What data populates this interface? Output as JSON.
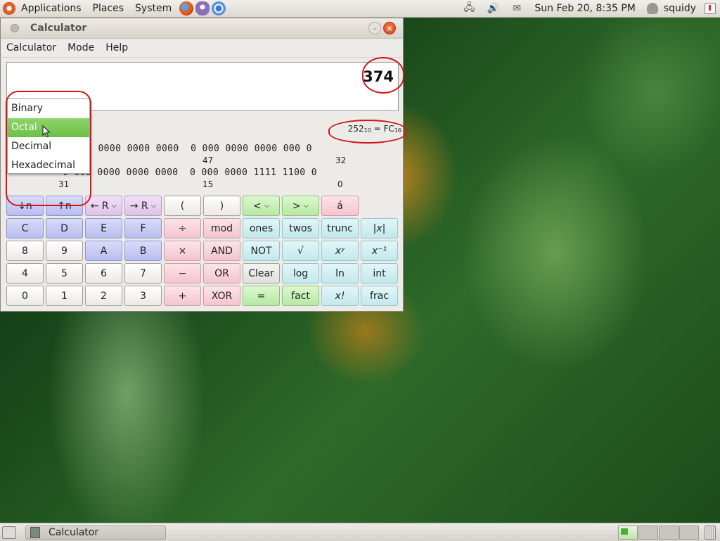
{
  "top_panel": {
    "menus": [
      "Applications",
      "Places",
      "System"
    ],
    "clock": "Sun Feb 20,  8:35 PM",
    "user": "squidy"
  },
  "window": {
    "title": "Calculator",
    "menus": [
      "Calculator",
      "Mode",
      "Help"
    ]
  },
  "display": {
    "value": "374"
  },
  "conversion": {
    "left": "252",
    "left_base": "10",
    "eq": " = ",
    "right": "FC",
    "right_base": "16"
  },
  "bits": {
    "row1": "0 0000 0000 0000  0 000 0000 0000 000 0",
    "row2": "0 000 0000 0000 0000  0 000 0000 1111 1100 0",
    "pos_47": "47",
    "pos_32": "32",
    "pos_31": "31",
    "pos_15": "15",
    "pos_0": "0"
  },
  "mode_menu": {
    "items": [
      "Binary",
      "Octal",
      "Decimal",
      "Hexadecimal"
    ],
    "selected": "Octal"
  },
  "buttons": {
    "row1": [
      "↓n",
      "↑n",
      "← R",
      "→ R",
      "(",
      ")",
      "<",
      ">",
      "á"
    ],
    "row2": [
      "C",
      "D",
      "E",
      "F",
      "÷",
      "mod",
      "ones",
      "twos",
      "trunc",
      "|x|"
    ],
    "row3": [
      "8",
      "9",
      "A",
      "B",
      "×",
      "AND",
      "NOT",
      "√",
      "xʸ",
      "x⁻¹"
    ],
    "row4": [
      "4",
      "5",
      "6",
      "7",
      "−",
      "OR",
      "Clear",
      "log",
      "ln",
      "int"
    ],
    "row5": [
      "0",
      "1",
      "2",
      "3",
      "+",
      "XOR",
      "=",
      "fact",
      "x!",
      "frac"
    ]
  },
  "taskbar": {
    "task": "Calculator"
  }
}
